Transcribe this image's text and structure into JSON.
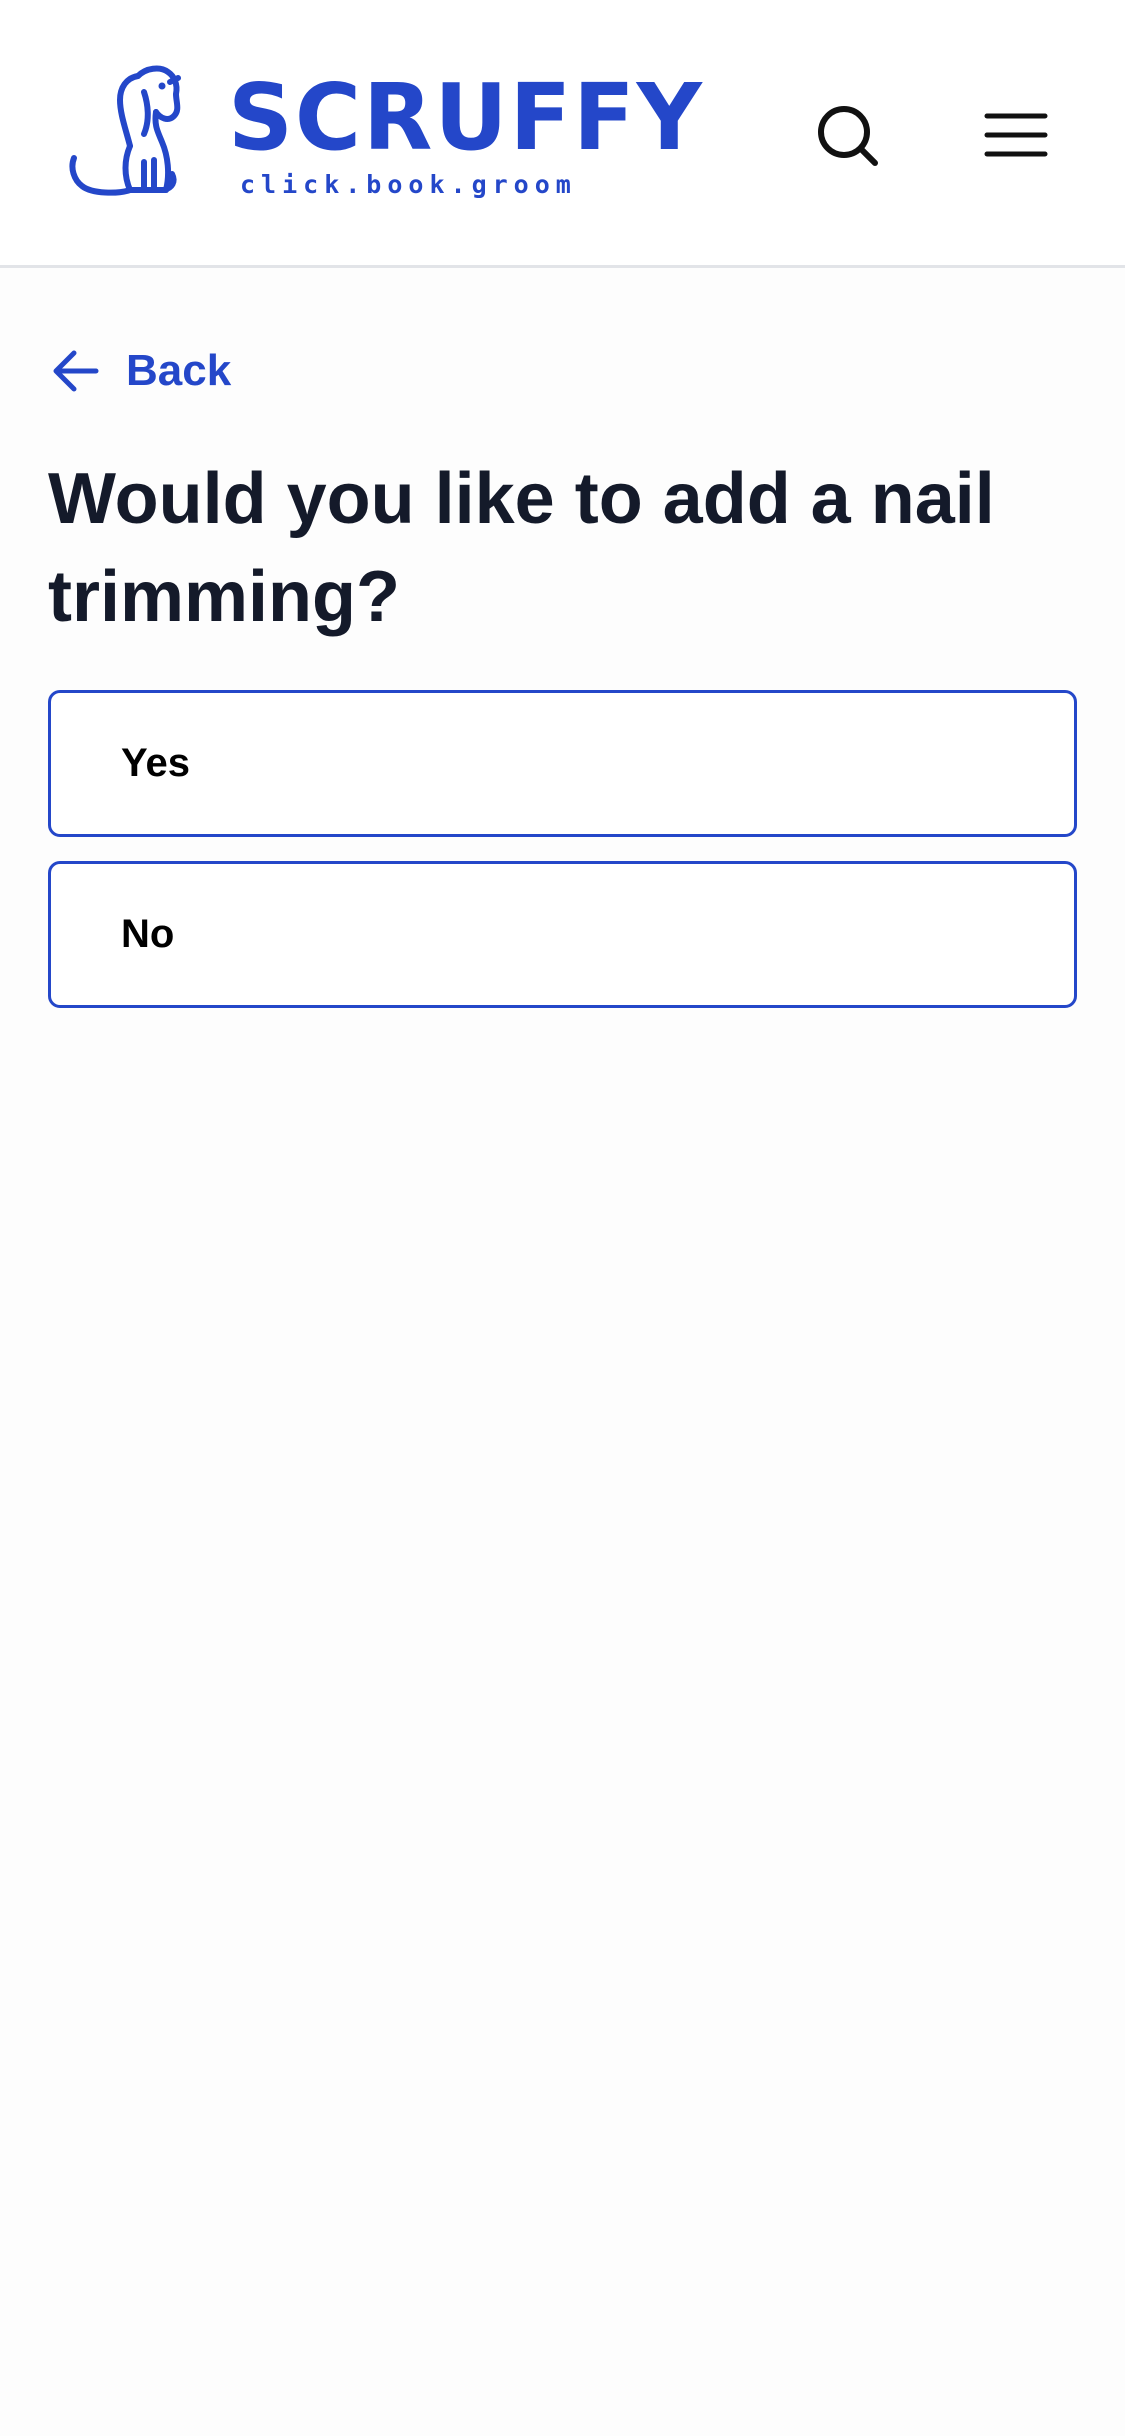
{
  "header": {
    "logo": {
      "wordmark": "SCRUFFY",
      "tagline": "click.book.groom",
      "icon": "dog-icon"
    },
    "search_icon": "search-icon",
    "menu_icon": "hamburger-menu-icon"
  },
  "nav": {
    "back_label": "Back",
    "back_icon": "arrow-left-icon"
  },
  "question": {
    "title": "Would you like to add a nail trimming?"
  },
  "options": [
    {
      "label": "Yes"
    },
    {
      "label": "No"
    }
  ],
  "colors": {
    "brand": "#2447c9",
    "heading": "#141a2a",
    "border": "#2447c9",
    "header_divider": "#e2e4e8"
  }
}
